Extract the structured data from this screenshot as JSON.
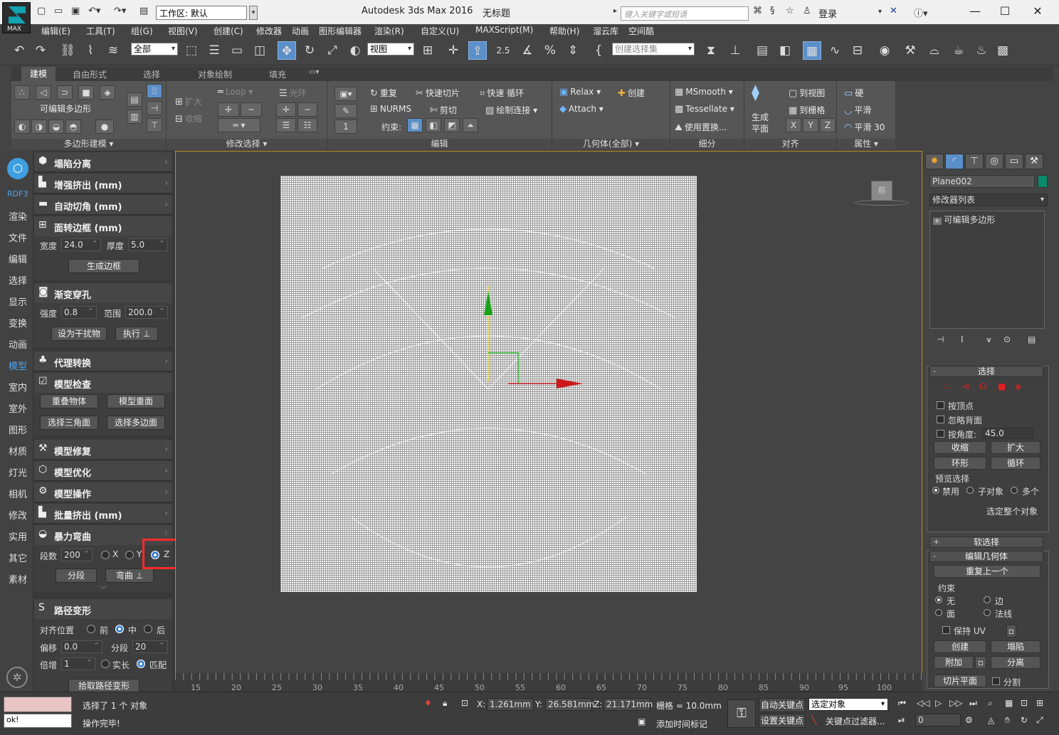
{
  "titlebar": {
    "workspace_label": "工作区: 默认",
    "app_title": "Autodesk 3ds Max 2016",
    "doc_title": "无标题",
    "search_placeholder": "键入关键字或短语",
    "login": "登录",
    "logo_text": "MAX"
  },
  "menu": [
    "编辑(E)",
    "工具(T)",
    "组(G)",
    "视图(V)",
    "创建(C)",
    "修改器",
    "动画",
    "图形编辑器",
    "渲染(R)",
    "自定义(U)",
    "MAXScript(M)",
    "帮助(H)",
    "溜云库",
    "空间酷"
  ],
  "toolbar": {
    "filter_select": "全部",
    "refcoord_select": "视图",
    "snap_label": "2.5",
    "named_sel_placeholder": "创建选择集"
  },
  "ribbon_tabs": [
    "建模",
    "自由形式",
    "选择",
    "对象绘制",
    "填充"
  ],
  "ribbon": {
    "poly_modeling": {
      "label": "可编辑多边形",
      "footer": "多边形建模 ▾"
    },
    "modify_selection": {
      "grow": "扩大",
      "shrink": "收缩",
      "loop": "Loop",
      "ring": "光环",
      "footer": "修改选择 ▾"
    },
    "edit": {
      "repeat": "重复",
      "quickslice": "快速切片",
      "quickloop": "快速 循环",
      "nurms": "NURMS",
      "cut": "剪切",
      "paintconnect": "绘制连接",
      "constraint": "约束:",
      "spinner": "1",
      "footer": "编辑"
    },
    "geometry": {
      "relax": "Relax",
      "create": "创建",
      "attach": "Attach",
      "footer": "几何体(全部) ▾"
    },
    "subdivision": {
      "msmooth": "MSmooth",
      "tessellate": "Tessellate",
      "displace": "使用置换...",
      "footer": "细分"
    },
    "align": {
      "make_planar_1": "生成",
      "make_planar_2": "平面",
      "to_view": "到视图",
      "to_grid": "到栅格",
      "x": "X",
      "y": "Y",
      "z": "Z",
      "footer": "对齐"
    },
    "properties": {
      "hard": "硬",
      "smooth": "平滑",
      "smooth30": "平滑 30",
      "footer": "属性 ▾"
    }
  },
  "left_strip": {
    "logo": "RDF3",
    "tabs": [
      "渲染",
      "文件",
      "编辑",
      "选择",
      "显示",
      "变换",
      "动画",
      "模型",
      "室内",
      "室外",
      "图形",
      "材质",
      "灯光",
      "相机",
      "修改",
      "实用",
      "其它",
      "素材"
    ],
    "active": "模型"
  },
  "left_panel": {
    "collapse": "塌陷分离",
    "enhance_extrude": "增强挤出 (mm)",
    "auto_chamfer": "自动切角 (mm)",
    "face_border": "面转边框 (mm)",
    "width_label": "宽度",
    "width_value": "24.0",
    "thickness_label": "厚度",
    "thickness_value": "5.0",
    "gen_border": "生成边框",
    "gradient_hole": "渐变穿孔",
    "strength_label": "强度",
    "strength_value": "0.8",
    "range_label": "范围",
    "range_value": "200.0",
    "set_interferer": "设为干扰物",
    "execute": "执行",
    "proxy_convert": "代理转换",
    "model_check": "模型检查",
    "overlap": "重叠物体",
    "model_dup_face": "模型重面",
    "sel_tri": "选择三角面",
    "sel_poly": "选择多边面",
    "model_repair": "模型修复",
    "model_opt": "模型优化",
    "model_op": "模型操作",
    "batch_extrude": "批量挤出 (mm)",
    "force_bend": "暴力弯曲",
    "segments_label": "段数",
    "segments_value": "200",
    "axis_x": "X",
    "axis_y": "Y",
    "axis_z": "Z",
    "segment_btn": "分段",
    "bend_btn": "弯曲",
    "path_deform": "路径变形",
    "align_pos": "对齐位置",
    "front": "前",
    "middle": "中",
    "back": "后",
    "offset_label": "偏移",
    "offset_value": "0.0",
    "seg2_label": "分段",
    "seg2_value": "20",
    "mult_label": "倍增",
    "mult_value": "1",
    "actual_len": "实长",
    "match": "匹配",
    "pick_path": "拾取路径变形"
  },
  "viewport": {
    "viewcube_label": "前"
  },
  "command_panel": {
    "object_name": "Plane002",
    "modifier_list": "修改器列表",
    "stack_item": "可编辑多边形",
    "selection_title": "选择",
    "by_vertex": "按顶点",
    "ignore_backfacing": "忽略背面",
    "by_angle": "按角度:",
    "angle_value": "45.0",
    "shrink": "收缩",
    "grow": "扩大",
    "ring": "环形",
    "loop": "循环",
    "preview_sel": "预览选择",
    "disabled": "禁用",
    "subobj": "子对象",
    "multi": "多个",
    "whole_obj": "选定整个对象",
    "soft_sel": "软选择",
    "edit_geom": "编辑几何体",
    "repeat_last": "重复上一个",
    "constraints": "约束",
    "none": "无",
    "edge": "边",
    "face": "面",
    "normal": "法线",
    "preserve_uv": "保持 UV",
    "create": "创建",
    "collapse": "塌陷",
    "attach": "附加",
    "detach": "分离",
    "slice_plane": "切片平面",
    "split": "分割"
  },
  "timeline": {
    "ticks": [
      "15",
      "20",
      "25",
      "30",
      "35",
      "40",
      "45",
      "50",
      "55",
      "60",
      "65",
      "70",
      "75",
      "80",
      "85",
      "90",
      "95",
      "100"
    ]
  },
  "status": {
    "maxscript_text": "ok!",
    "selected": "选择了 1 个 对象",
    "done": "操作完毕!",
    "x_label": "X:",
    "x_value": "1.261mm",
    "y_label": "Y:",
    "y_value": "26.581mm",
    "z_label": "Z:",
    "z_value": "21.171mm",
    "grid": "栅格 = 10.0mm",
    "add_time_tag": "添加时间标记",
    "auto_key": "自动关键点",
    "selected_obj": "选定对象",
    "set_key": "设置关键点",
    "key_filter": "关键点过滤器...",
    "frame_value": "0"
  }
}
